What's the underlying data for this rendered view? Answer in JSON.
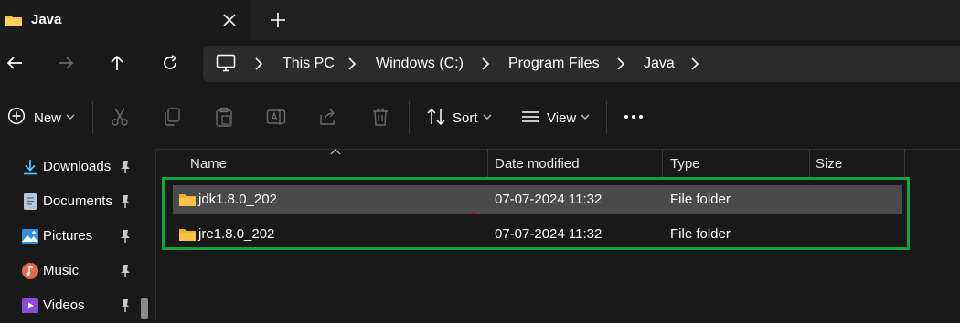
{
  "tab": {
    "title": "Java",
    "icon": "folder-icon"
  },
  "nav": {
    "back": "back-arrow-icon",
    "forward": "forward-arrow-icon",
    "up": "up-arrow-icon",
    "refresh": "refresh-icon"
  },
  "breadcrumb": [
    "This PC",
    "Windows (C:)",
    "Program Files",
    "Java"
  ],
  "toolbar": {
    "new_label": "New",
    "sort_label": "Sort",
    "view_label": "View",
    "icons": [
      "cut-icon",
      "copy-icon",
      "paste-icon",
      "rename-icon",
      "share-icon",
      "delete-icon",
      "more-icon"
    ]
  },
  "sidebar": {
    "items": [
      {
        "label": "Downloads",
        "icon": "download-icon"
      },
      {
        "label": "Documents",
        "icon": "documents-icon"
      },
      {
        "label": "Pictures",
        "icon": "pictures-icon"
      },
      {
        "label": "Music",
        "icon": "music-icon"
      },
      {
        "label": "Videos",
        "icon": "videos-icon"
      }
    ]
  },
  "columns": [
    "Name",
    "Date modified",
    "Type",
    "Size"
  ],
  "files": [
    {
      "name": "jdk1.8.0_202",
      "date": "07-07-2024 11:32",
      "type": "File folder",
      "size": ""
    },
    {
      "name": "jre1.8.0_202",
      "date": "07-07-2024 11:32",
      "type": "File folder",
      "size": ""
    }
  ],
  "colors": {
    "folder": "#f6c344",
    "highlight_border": "#16a33a",
    "selected_row": "#4a4a4a"
  }
}
